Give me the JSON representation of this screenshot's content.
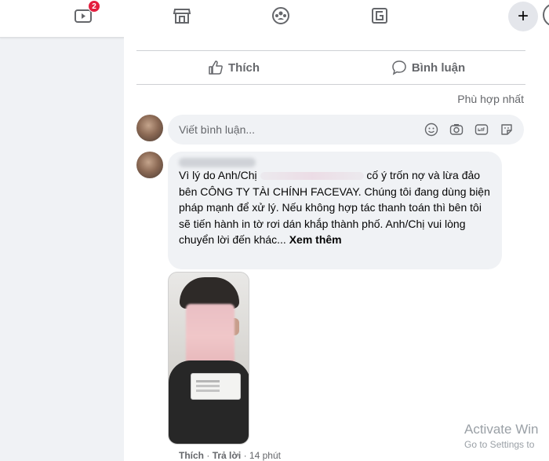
{
  "nav": {
    "watch_badge": "2",
    "icons": [
      "watch-icon",
      "marketplace-icon",
      "groups-icon",
      "gaming-icon",
      "plus-icon"
    ],
    "create_label": "+"
  },
  "actions": {
    "like_label": "Thích",
    "comment_label": "Bình luận"
  },
  "sort": {
    "label": "Phù hợp nhất"
  },
  "comment_box": {
    "placeholder": "Viết bình luận...",
    "icons": [
      "emoji-icon",
      "camera-icon",
      "gif-icon",
      "sticker-icon"
    ]
  },
  "comment": {
    "text_line1_a": "Vì lý do Anh/Chị",
    "text_line1_b": "cố ý trốn nợ và lừa",
    "text_rest": "đảo bên CÔNG TY TÀI CHÍNH FACEVAY. Chúng tôi đang dùng biện pháp mạnh để xử lý. Nếu không hợp tác thanh toán thì bên tôi sẽ tiến hành in tờ rơi dán khắp thành phố. Anh/Chị vui lòng chuyển lời đến khác...",
    "see_more": "Xem thêm"
  },
  "comment_meta": {
    "like": "Thích",
    "reply": "Trả lời",
    "separator": "·",
    "time": "14 phút"
  },
  "watermark": {
    "line1": "Activate Win",
    "line2": "Go to Settings to"
  },
  "colors": {
    "badge": "#e41e3f",
    "secondary_text": "#65676b",
    "bubble_bg": "#f0f2f5"
  }
}
